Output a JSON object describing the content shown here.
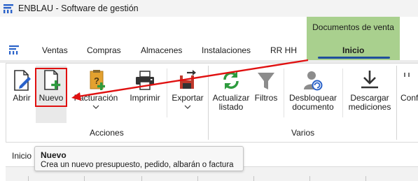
{
  "window": {
    "title": "ENBLAU - Software de gestión"
  },
  "context_group": {
    "label": "Documentos de venta"
  },
  "tabs": [
    {
      "label": "Ventas"
    },
    {
      "label": "Compras"
    },
    {
      "label": "Almacenes"
    },
    {
      "label": "Instalaciones"
    },
    {
      "label": "RR HH"
    },
    {
      "label": "Inicio",
      "active": true
    }
  ],
  "ribbon": {
    "buttons": {
      "abrir": "Abrir",
      "nuevo": "Nuevo",
      "facturacion": "Facturación",
      "imprimir": "Imprimir",
      "exportar": "Exportar",
      "actualizar_1": "Actualizar",
      "actualizar_2": "listado",
      "filtros": "Filtros",
      "desbloquear_1": "Desbloquear",
      "desbloquear_2": "documento",
      "descargar_1": "Descargar",
      "descargar_2": "mediciones",
      "config": "Conf"
    },
    "groups": {
      "acciones": "Acciones",
      "varios": "Varios"
    }
  },
  "tooltip": {
    "title": "Nuevo",
    "description": "Crea un nuevo presupuesto, pedido, albarán o factura"
  },
  "content": {
    "title": "Inicio"
  },
  "colors": {
    "context_green": "#a9d08e",
    "active_underline": "#1f4e9c",
    "annotation_red": "#e01010",
    "icon_blue": "#2a62c9",
    "icon_green": "#2e9b3e",
    "icon_orange": "#e3a12f",
    "icon_red": "#c0392b"
  }
}
